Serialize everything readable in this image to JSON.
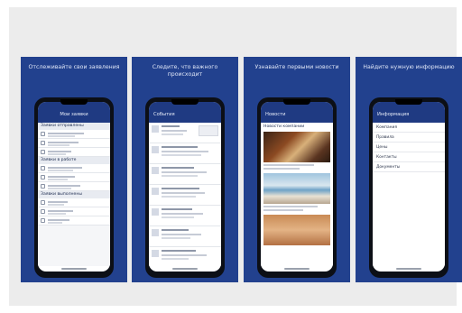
{
  "background_color": "#ececec",
  "panel_color": "#22418e",
  "panels": [
    {
      "caption": "Отслеживайте свои заявления",
      "screen_title": "Мои заявки",
      "sections": [
        "Заявки отправлены",
        "Заявки в работе",
        "Заявки выполнены"
      ]
    },
    {
      "caption": "Следите, что важного происходит",
      "screen_title": "События"
    },
    {
      "caption": "Узнавайте первыми новости",
      "screen_title": "Новости",
      "news_header": "Новости компании"
    },
    {
      "caption": "Найдите нужную информацию",
      "screen_title": "Информация",
      "items": [
        "Компания",
        "Правила",
        "Цены",
        "Контакты",
        "Документы"
      ]
    }
  ]
}
